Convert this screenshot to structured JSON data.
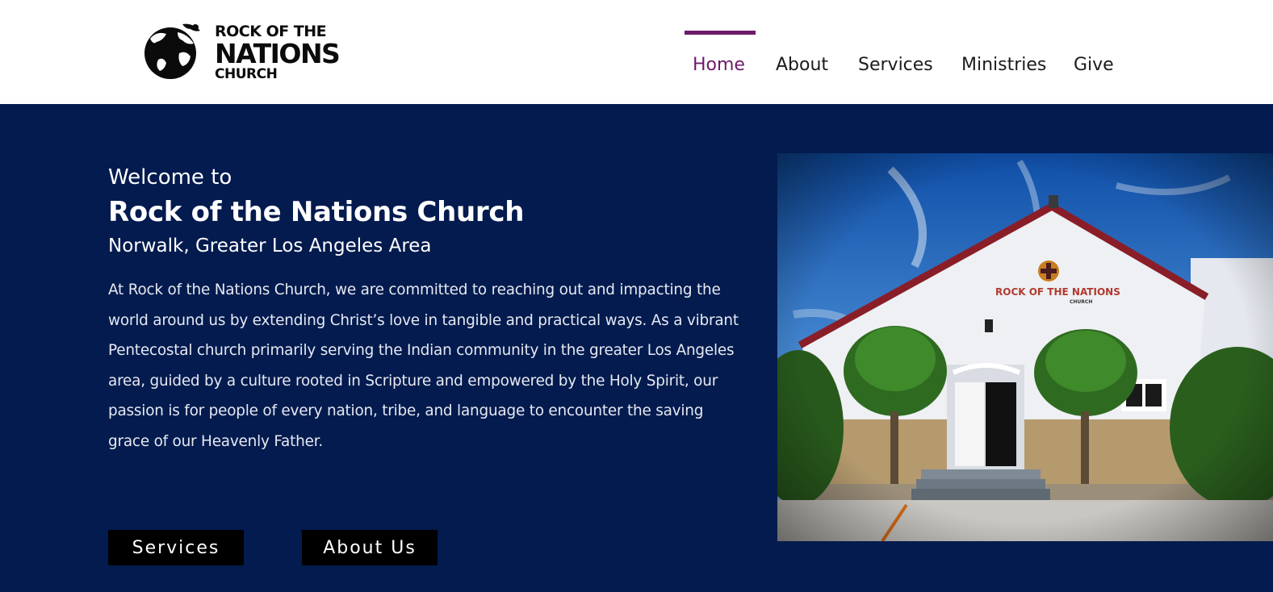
{
  "header": {
    "logo": {
      "line1": "ROCK OF THE",
      "line2": "NATIONS",
      "line3": "CHURCH"
    },
    "nav": [
      {
        "label": "Home",
        "active": true
      },
      {
        "label": "About",
        "active": false
      },
      {
        "label": "Services",
        "active": false
      },
      {
        "label": "Ministries",
        "active": false
      },
      {
        "label": "Give",
        "active": false
      }
    ]
  },
  "hero": {
    "welcome": "Welcome to",
    "title": "Rock of the Nations Church",
    "subtitle": "Norwalk, Greater Los Angeles Area",
    "body": "At Rock of the Nations Church, we are committed to reaching out and impacting the world around us by extending Christ’s love in tangible and practical ways. As a vibrant Pentecostal church primarily serving the Indian community in the greater Los Angeles area, guided by a culture rooted in Scripture and empowered by the Holy Spirit, our passion is for people of every nation, tribe, and language to encounter the saving grace of our Heavenly Father.",
    "buttons": {
      "services": "Services",
      "about": "About Us"
    },
    "photo": {
      "sign_line1": "ROCK OF THE NATIONS",
      "sign_line2": "CHURCH"
    }
  },
  "colors": {
    "accent": "#6e1a6b",
    "hero_bg": "#031b4e",
    "button_bg": "#000000",
    "text_dark": "#1b1b1b"
  },
  "icons": {
    "logo_mark": "globe-icon"
  }
}
